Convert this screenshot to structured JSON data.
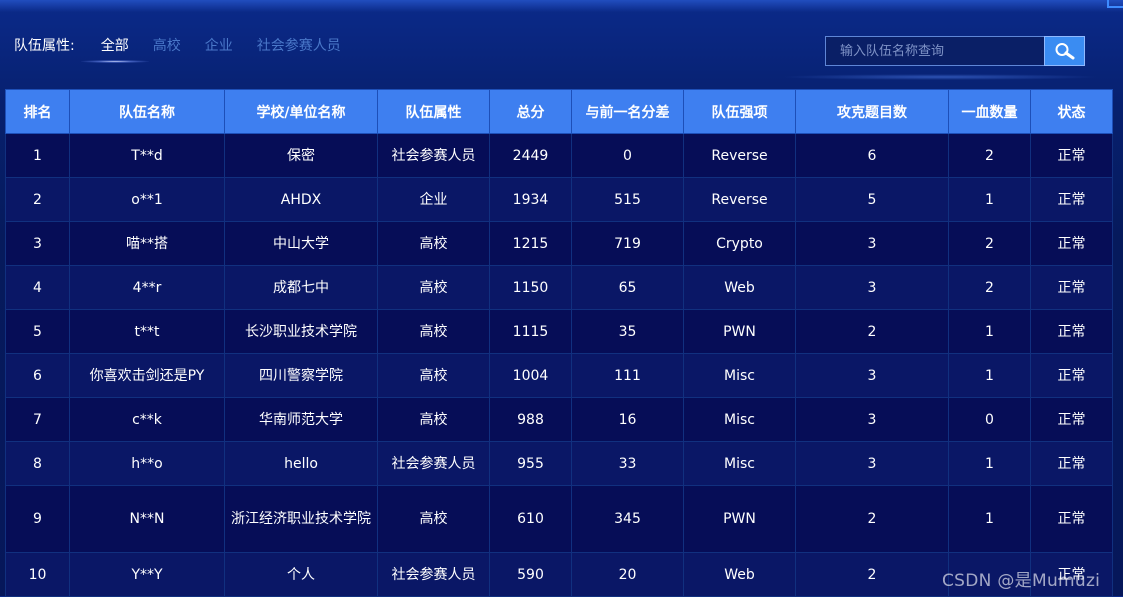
{
  "filter": {
    "label": "队伍属性:",
    "tabs": [
      {
        "label": "全部",
        "active": true
      },
      {
        "label": "高校",
        "active": false
      },
      {
        "label": "企业",
        "active": false
      },
      {
        "label": "社会参赛人员",
        "active": false
      }
    ]
  },
  "search": {
    "placeholder": "输入队伍名称查询",
    "icon": "search-icon"
  },
  "table": {
    "headers": [
      "排名",
      "队伍名称",
      "学校/单位名称",
      "队伍属性",
      "总分",
      "与前一名分差",
      "队伍强项",
      "攻克题目数",
      "一血数量",
      "状态"
    ],
    "rows": [
      [
        "1",
        "T**d",
        "保密",
        "社会参赛人员",
        "2449",
        "0",
        "Reverse",
        "6",
        "2",
        "正常"
      ],
      [
        "2",
        "o**1",
        "AHDX",
        "企业",
        "1934",
        "515",
        "Reverse",
        "5",
        "1",
        "正常"
      ],
      [
        "3",
        "喵**搭",
        "中山大学",
        "高校",
        "1215",
        "719",
        "Crypto",
        "3",
        "2",
        "正常"
      ],
      [
        "4",
        "4**r",
        "成都七中",
        "高校",
        "1150",
        "65",
        "Web",
        "3",
        "2",
        "正常"
      ],
      [
        "5",
        "t**t",
        "长沙职业技术学院",
        "高校",
        "1115",
        "35",
        "PWN",
        "2",
        "1",
        "正常"
      ],
      [
        "6",
        "你喜欢击剑还是PY",
        "四川警察学院",
        "高校",
        "1004",
        "111",
        "Misc",
        "3",
        "1",
        "正常"
      ],
      [
        "7",
        "c**k",
        "华南师范大学",
        "高校",
        "988",
        "16",
        "Misc",
        "3",
        "0",
        "正常"
      ],
      [
        "8",
        "h**o",
        "hello",
        "社会参赛人员",
        "955",
        "33",
        "Misc",
        "3",
        "1",
        "正常"
      ],
      [
        "9",
        "N**N",
        "浙江经济职业技术学院",
        "高校",
        "610",
        "345",
        "PWN",
        "2",
        "1",
        "正常"
      ],
      [
        "10",
        "Y**Y",
        "个人",
        "社会参赛人员",
        "590",
        "20",
        "Web",
        "2",
        "",
        "正常"
      ]
    ]
  },
  "watermark": "CSDN @是Mumuzi",
  "colors": {
    "header_bg": "#3e7ff0",
    "row_odd": "#060d57",
    "row_even": "#0a1766",
    "accent": "#3a8cf2"
  }
}
